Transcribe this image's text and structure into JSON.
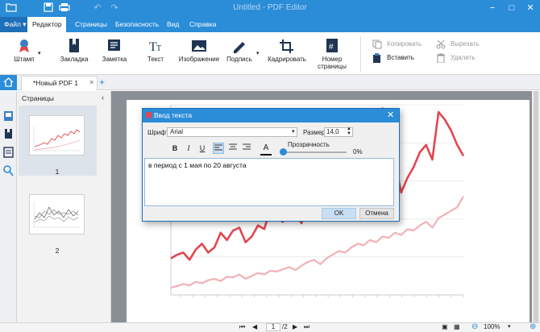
{
  "window": {
    "title": "Untitled - PDF Editor"
  },
  "menu": {
    "file": "Файл",
    "editor": "Редактор",
    "pages": "Страницы",
    "security": "Безопасность",
    "view": "Вид",
    "help": "Справка"
  },
  "ribbon": {
    "stamp": "Штамп",
    "bookmark": "Закладка",
    "note": "Заметка",
    "text": "Текст",
    "image": "Изображение",
    "signature": "Подпись",
    "crop": "Кадрировать",
    "page_number": "Номер страницы",
    "copy": "Копировать",
    "paste": "Вставить",
    "cut": "Вырезать",
    "delete": "Удалить"
  },
  "tabs": {
    "document": "*Новый PDF 1",
    "close": "×",
    "add": "+"
  },
  "pages_panel": {
    "title": "Страницы",
    "collapse": "‹",
    "page1": "1",
    "page2": "2"
  },
  "dialog": {
    "title": "Ввод текста",
    "font_label": "Шрифт",
    "font_value": "Arial",
    "size_label": "Размер",
    "size_value": "14,0",
    "bold": "B",
    "italic": "I",
    "underline": "U",
    "color": "A",
    "opacity_label": "Прозрачность",
    "opacity_value": "0%",
    "text": "в период с 1 мая по 20 августа",
    "ok": "OK",
    "cancel": "Отмена"
  },
  "status": {
    "page_current": "1",
    "page_total": "/2",
    "zoom": "100%"
  },
  "colors": {
    "accent": "#2b8cd8",
    "series_main": "#e2474f",
    "series_light": "#f2b1b5"
  },
  "chart_data": {
    "type": "line",
    "series": [
      {
        "values": [
          50,
          55,
          58,
          48,
          62,
          70,
          58,
          65,
          85,
          75,
          88,
          92,
          72,
          80,
          95,
          90,
          118,
          105,
          100,
          125,
          110,
          98,
          140,
          150,
          160,
          175,
          205,
          235,
          250,
          230,
          185,
          215,
          205,
          240,
          255,
          195,
          180,
          140,
          160,
          175,
          195,
          205,
          185,
          250,
          240,
          225,
          205,
          190
        ]
      },
      {
        "values": [
          10,
          12,
          15,
          13,
          18,
          16,
          20,
          22,
          19,
          25,
          24,
          28,
          22,
          26,
          30,
          28,
          33,
          32,
          35,
          38,
          34,
          40,
          45,
          48,
          42,
          50,
          55,
          60,
          58,
          65,
          70,
          68,
          75,
          72,
          80,
          78,
          85,
          82,
          90,
          88,
          95,
          100,
          92,
          105,
          110,
          115,
          120,
          135
        ]
      }
    ]
  }
}
